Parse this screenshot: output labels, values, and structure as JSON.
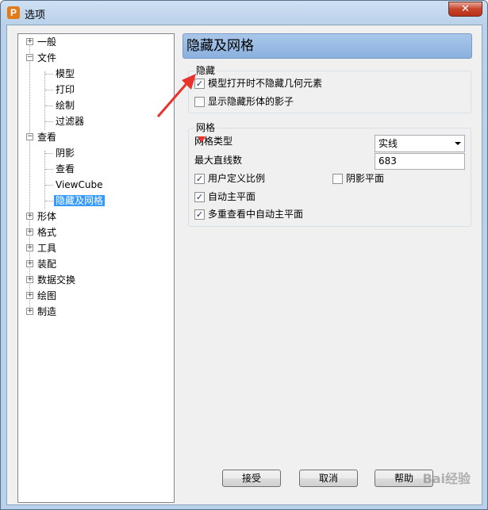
{
  "window": {
    "title": "选项",
    "close": "✕",
    "app_icon": "P"
  },
  "tree": {
    "items": [
      {
        "label": "一般",
        "expander": "+"
      },
      {
        "label": "文件",
        "expander": "−"
      },
      {
        "label": "模型"
      },
      {
        "label": "打印"
      },
      {
        "label": "绘制"
      },
      {
        "label": "过滤器"
      },
      {
        "label": "查看",
        "expander": "−"
      },
      {
        "label": "阴影"
      },
      {
        "label": "查看"
      },
      {
        "label": "ViewCube"
      },
      {
        "label": "隐藏及网格",
        "selected": true
      },
      {
        "label": "形体",
        "expander": "+"
      },
      {
        "label": "格式",
        "expander": "+"
      },
      {
        "label": "工具",
        "expander": "+"
      },
      {
        "label": "装配",
        "expander": "+"
      },
      {
        "label": "数据交换",
        "expander": "+"
      },
      {
        "label": "绘图",
        "expander": "+"
      },
      {
        "label": "制造",
        "expander": "+"
      }
    ]
  },
  "panel": {
    "header": "隐藏及网格",
    "hide_group": {
      "title": "隐藏",
      "opt1": {
        "label": "模型打开时不隐藏几何元素",
        "checked": "✓"
      },
      "opt2": {
        "label": "显示隐藏形体的影子",
        "checked": ""
      }
    },
    "grid_group": {
      "title": "网格",
      "type_label": "网格类型",
      "type_value": "实线",
      "max_lines_label": "最大直线数",
      "max_lines_value": "683",
      "user_scale": {
        "label": "用户定义比例",
        "checked": "✓"
      },
      "shadow_plane": {
        "label": "阴影平面",
        "checked": ""
      },
      "auto_plane": {
        "label": "自动主平面",
        "checked": "✓"
      },
      "multi_auto_plane": {
        "label": "多重查看中自动主平面",
        "checked": "✓"
      }
    }
  },
  "buttons": {
    "ok": "接受",
    "cancel": "取消",
    "help": "帮助"
  },
  "watermark": "Bai经验",
  "colors": {
    "annotation_arrow": "#e8322b",
    "selection": "#3399ff"
  }
}
